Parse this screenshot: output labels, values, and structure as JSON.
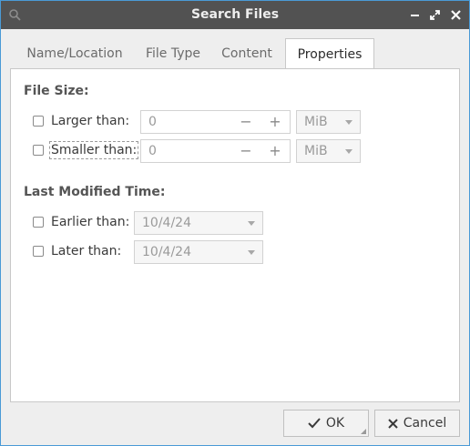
{
  "window": {
    "title": "Search Files"
  },
  "titlebar_icons": {
    "left": "search-icon",
    "minimize": "minimize-icon",
    "maximize": "maximize-icon",
    "close": "close-icon"
  },
  "tabs": [
    {
      "label": "Name/Location",
      "active": false
    },
    {
      "label": "File Type",
      "active": false
    },
    {
      "label": "Content",
      "active": false
    },
    {
      "label": "Properties",
      "active": true
    }
  ],
  "file_size": {
    "title": "File Size:",
    "larger": {
      "label": "Larger than:",
      "checked": false,
      "value": "0",
      "unit": "MiB"
    },
    "smaller": {
      "label": "Smaller than:",
      "checked": false,
      "value": "0",
      "unit": "MiB"
    }
  },
  "last_modified": {
    "title": "Last Modified Time:",
    "earlier": {
      "label": "Earlier than:",
      "checked": false,
      "date": "10/4/24"
    },
    "later": {
      "label": "Later than:",
      "checked": false,
      "date": "10/4/24"
    }
  },
  "buttons": {
    "ok": "OK",
    "cancel": "Cancel"
  },
  "colors": {
    "titlebar": "#525252",
    "accent_border": "#4a9ad6",
    "cancel_icon": "#3a3a3a"
  }
}
